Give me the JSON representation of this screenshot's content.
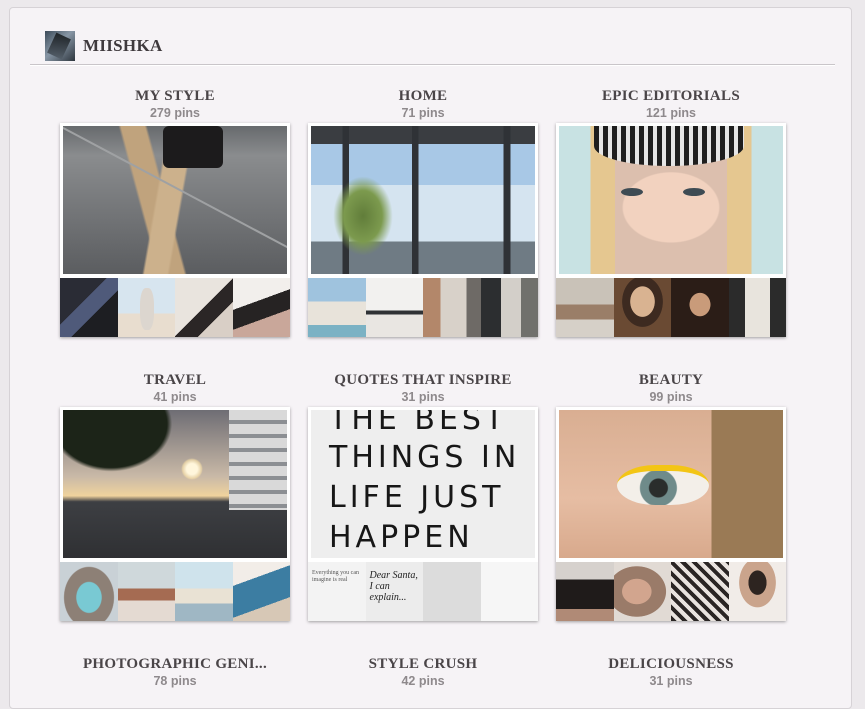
{
  "profile": {
    "name": "MIISHKA",
    "avatar_icon": "profile-photo"
  },
  "boards": [
    {
      "title": "MY STYLE",
      "count": "279 pins"
    },
    {
      "title": "HOME",
      "count": "71 pins"
    },
    {
      "title": "EPIC EDITORIALS",
      "count": "121 pins"
    },
    {
      "title": "TRAVEL",
      "count": "41 pins"
    },
    {
      "title": "QUOTES THAT INSPIRE",
      "count": "31 pins",
      "cover_text": [
        "THE BEST",
        "THINGS IN",
        "LIFE JUST",
        "HAPPEN"
      ],
      "thumb_text": [
        "Everything you can imagine is real",
        "Dear Santa, I can explain...",
        "",
        ""
      ]
    },
    {
      "title": "BEAUTY",
      "count": "99 pins"
    },
    {
      "title": "PHOTOGRAPHIC GENI...",
      "count": "78 pins"
    },
    {
      "title": "STYLE CRUSH",
      "count": "42 pins"
    },
    {
      "title": "DELICIOUSNESS",
      "count": "31 pins"
    }
  ],
  "colors": {
    "accent_title": "#4a4548",
    "count_text": "#8e898c",
    "background": "#f6f3f6"
  }
}
